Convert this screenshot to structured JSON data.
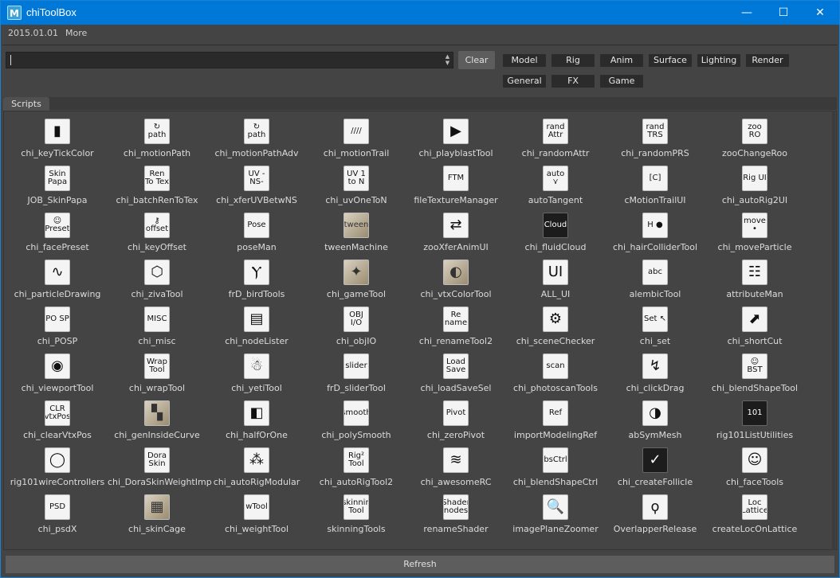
{
  "window": {
    "title": "chiToolBox",
    "app_icon": "M"
  },
  "controls": {
    "minimize": "—",
    "maximize": "☐",
    "close": "✕"
  },
  "menu": {
    "version": "2015.01.01",
    "more": "More"
  },
  "search": {
    "value": "",
    "placeholder": ""
  },
  "clear_label": "Clear",
  "categories": [
    "Model",
    "Rig",
    "Anim",
    "Surface",
    "Lighting",
    "Render",
    "General",
    "FX",
    "Game"
  ],
  "tab_label": "Scripts",
  "refresh_label": "Refresh",
  "tools": [
    {
      "label": "chi_keyTickColor",
      "icon": "▮"
    },
    {
      "label": "chi_motionPath",
      "icon": "↻ path"
    },
    {
      "label": "chi_motionPathAdv",
      "icon": "↻ path"
    },
    {
      "label": "chi_motionTrail",
      "icon": "////"
    },
    {
      "label": "chi_playblastTool",
      "icon": "▶"
    },
    {
      "label": "chi_randomAttr",
      "icon": "rand Attr"
    },
    {
      "label": "chi_randomPRS",
      "icon": "rand TRS"
    },
    {
      "label": "zooChangeRoo",
      "icon": "zoo RO"
    },
    {
      "label": "JOB_SkinPapa",
      "icon": "Skin Papa"
    },
    {
      "label": "chi_batchRenToTex",
      "icon": "Ren To Tex"
    },
    {
      "label": "chi_xferUVBetwNS",
      "icon": "UV -NS-"
    },
    {
      "label": "chi_uvOneToN",
      "icon": "UV 1 to N"
    },
    {
      "label": "fileTextureManager",
      "icon": "FTM"
    },
    {
      "label": "autoTangent",
      "icon": "auto ⋎"
    },
    {
      "label": "cMotionTrailUI",
      "icon": "[C]"
    },
    {
      "label": "chi_autoRig2UI",
      "icon": "Rig UI"
    },
    {
      "label": "chi_facePreset",
      "icon": "☺ Preset"
    },
    {
      "label": "chi_keyOffset",
      "icon": "⚷ offset"
    },
    {
      "label": "poseMan",
      "icon": "Pose"
    },
    {
      "label": "tweenMachine",
      "icon": "tween"
    },
    {
      "label": "zooXferAnimUI",
      "icon": "⇄"
    },
    {
      "label": "chi_fluidCloud",
      "icon": "Cloud"
    },
    {
      "label": "chi_hairColliderTool",
      "icon": "H ●"
    },
    {
      "label": "chi_moveParticle",
      "icon": "move •"
    },
    {
      "label": "chi_particleDrawing",
      "icon": "∿"
    },
    {
      "label": "chi_zivaTool",
      "icon": "⬡"
    },
    {
      "label": "frD_birdTools",
      "icon": "Ⲩ"
    },
    {
      "label": "chi_gameTool",
      "icon": "✦"
    },
    {
      "label": "chi_vtxColorTool",
      "icon": "◐"
    },
    {
      "label": "ALL_UI",
      "icon": "UI"
    },
    {
      "label": "alembicTool",
      "icon": "abc"
    },
    {
      "label": "attributeMan",
      "icon": "☷"
    },
    {
      "label": "chi_POSP",
      "icon": "PO SP"
    },
    {
      "label": "chi_misc",
      "icon": "MISC"
    },
    {
      "label": "chi_nodeLister",
      "icon": "▤"
    },
    {
      "label": "chi_objIO",
      "icon": "OBJ I/O"
    },
    {
      "label": "chi_renameTool2",
      "icon": "Re name"
    },
    {
      "label": "chi_sceneChecker",
      "icon": "⚙"
    },
    {
      "label": "chi_set",
      "icon": "Set ↖"
    },
    {
      "label": "chi_shortCut",
      "icon": "⬈"
    },
    {
      "label": "chi_viewportTool",
      "icon": "◉"
    },
    {
      "label": "chi_wrapTool",
      "icon": "Wrap Tool"
    },
    {
      "label": "chi_yetiTool",
      "icon": "☃"
    },
    {
      "label": "frD_sliderTool",
      "icon": "slider"
    },
    {
      "label": "chi_loadSaveSel",
      "icon": "Load Save"
    },
    {
      "label": "chi_photoscanTools",
      "icon": "scan"
    },
    {
      "label": "chi_clickDrag",
      "icon": "↯"
    },
    {
      "label": "chi_blendShapeTool",
      "icon": "☺ BST"
    },
    {
      "label": "chi_clearVtxPos",
      "icon": "CLR vtxPos"
    },
    {
      "label": "chi_genInsideCurve",
      "icon": "▚"
    },
    {
      "label": "chi_halfOrOne",
      "icon": "◧"
    },
    {
      "label": "chi_polySmooth",
      "icon": "smooth"
    },
    {
      "label": "chi_zeroPivot",
      "icon": "Pivot"
    },
    {
      "label": "importModelingRef",
      "icon": "Ref"
    },
    {
      "label": "abSymMesh",
      "icon": "◑"
    },
    {
      "label": "rig101ListUtilities",
      "icon": "101"
    },
    {
      "label": "rig101wireControllers",
      "icon": "◯"
    },
    {
      "label": "chi_DoraSkinWeightImp",
      "icon": "Dora Skin"
    },
    {
      "label": "chi_autoRigModular",
      "icon": "⁂"
    },
    {
      "label": "chi_autoRigTool2",
      "icon": "Rig² Tool"
    },
    {
      "label": "chi_awesomeRC",
      "icon": "≋"
    },
    {
      "label": "chi_blendShapeCtrl",
      "icon": "bsCtrl"
    },
    {
      "label": "chi_createFollicle",
      "icon": "✓"
    },
    {
      "label": "chi_faceTools",
      "icon": "☺"
    },
    {
      "label": "chi_psdX",
      "icon": "PSD"
    },
    {
      "label": "chi_skinCage",
      "icon": "▦"
    },
    {
      "label": "chi_weightTool",
      "icon": "wTool"
    },
    {
      "label": "skinningTools",
      "icon": "skinnin Tool"
    },
    {
      "label": "renameShader",
      "icon": "Shader nodes"
    },
    {
      "label": "imagePlaneZoomer",
      "icon": "🔍"
    },
    {
      "label": "OverlapperRelease",
      "icon": "ϙ"
    },
    {
      "label": "createLocOnLattice",
      "icon": "Loc Lattice"
    }
  ]
}
